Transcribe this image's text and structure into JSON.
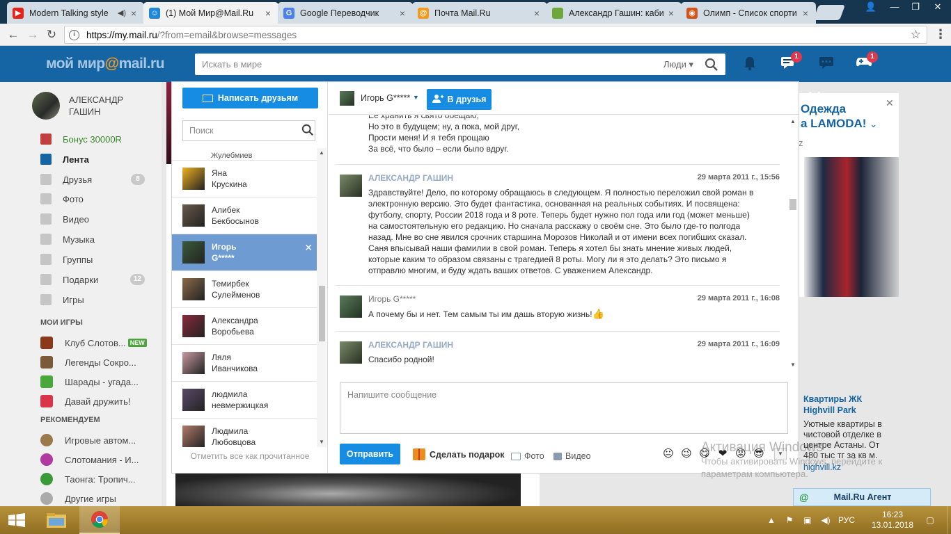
{
  "browser": {
    "tabs": [
      {
        "title": "Modern Talking style",
        "icon": "youtube-icon",
        "color": "#e62117",
        "audio": true
      },
      {
        "title": "(1) Мой Мир@Mail.Ru",
        "icon": "moimir-icon",
        "color": "#1f88d8",
        "active": true
      },
      {
        "title": "Google Переводчик",
        "icon": "google-translate-icon",
        "color": "#4a80ed"
      },
      {
        "title": "Почта Mail.Ru",
        "icon": "mailru-at-icon",
        "color": "#f19a1c"
      },
      {
        "title": "Александр Гашин: каби",
        "icon": "sheet-icon",
        "color": "#6ea83a"
      },
      {
        "title": "Олимп - Список спорти",
        "icon": "olimp-icon",
        "color": "#d3541b"
      }
    ],
    "url_host": "https://my.mail.ru",
    "url_rest": "/?from=email&browse=messages"
  },
  "header": {
    "logo_main": "мой мир",
    "logo_at": "@",
    "logo_suffix": "mail.ru",
    "search_placeholder": "Искать в мире",
    "search_scope": "Люди",
    "messages_badge": "1",
    "games_badge": "1"
  },
  "sidebar": {
    "user_name": "Александр Гашин",
    "items": [
      {
        "label": "Бонус 30000R",
        "type": "bonus"
      },
      {
        "label": "Лента",
        "type": "active"
      },
      {
        "label": "Друзья",
        "count": "8"
      },
      {
        "label": "Фото"
      },
      {
        "label": "Видео"
      },
      {
        "label": "Музыка"
      },
      {
        "label": "Группы"
      },
      {
        "label": "Подарки",
        "count": "12"
      },
      {
        "label": "Игры"
      }
    ],
    "my_games_title": "Мои игры",
    "my_games": [
      {
        "label": "Клуб Слотов...",
        "new": "NEW",
        "color": "#8a3a1a"
      },
      {
        "label": "Легенды Сокро...",
        "color": "#7a5a3a"
      },
      {
        "label": "Шарады - угада...",
        "color": "#4aa83a"
      },
      {
        "label": "Давай дружить!",
        "color": "#d8344a"
      }
    ],
    "recommended_title": "Рекомендуем",
    "recommended": [
      {
        "label": "Игровые автом...",
        "color": "#9a7a4a"
      },
      {
        "label": "Слотомания - И...",
        "color": "#b03aa0"
      },
      {
        "label": "Таонга: Тропич...",
        "color": "#3a9a3a"
      },
      {
        "label": "Другие игры",
        "color": "#aaaaaa"
      }
    ]
  },
  "dialog": {
    "write_friends_label": "Написать друзьям",
    "contacts_search_placeholder": "Поиск",
    "partial_contact": "Жулебмиев",
    "contacts": [
      {
        "name1": "Яна",
        "name2": "Крускина",
        "color": "#f0b020"
      },
      {
        "name1": "Алибек",
        "name2": "Бекбосынов",
        "color": "#6a5a4a"
      },
      {
        "name1": "Игорь",
        "name2": "G*****",
        "color": "#3a5a3a",
        "selected": true
      },
      {
        "name1": "Темирбек",
        "name2": "Сулейменов",
        "color": "#8a6a4a"
      },
      {
        "name1": "Александра",
        "name2": "Воробьева",
        "color": "#8a2a3a"
      },
      {
        "name1": "Ляля",
        "name2": "Иванчикова",
        "color": "#c89aa0"
      },
      {
        "name1": "людмила",
        "name2": "невмержицкая",
        "color": "#5a4a6a"
      },
      {
        "name1": "Людмила",
        "name2": "Любовцова",
        "color": "#b07a6a"
      }
    ],
    "mark_all_read": "Отметить все как прочитанное",
    "chat_name": "Игорь G*****",
    "add_friend_label": "В друзья",
    "poem_lines": [
      "Ее хранить я свято обещаю;",
      "Но это в будущем; ну, а пока, мой друг,",
      "Прости меня! И я тебя прощаю",
      "За всё, что было – если было вдруг."
    ],
    "messages": [
      {
        "author": "АЛЕКСАНДР ГАШИН",
        "date": "29 марта 2011 г., 15:56",
        "text": "Здравствуйте! Дело, по которому обращаюсь в следующем. Я полностью переложил свой роман в электронную версию. Это будет фантастика, основанная на реальных событиях. И посвящена: футболу, спорту, России 2018 года и 8 роте. Теперь будет нужно пол года или год (может меньше) на самостоятельную его редакцию. Но сначала расскажу о своём сне. Это было где-то полгода назад. Мне во сне явился срочник старшина Морозов Николай и от имени всех погибших сказал. Саня впысывай наши фамилии в свой роман. Теперь я хотел бы знать мнение живых людей, которые каким то образом связаны с трагедией 8 роты. Могу ли я это делать? Это письмо я отправлю многим, и буду ждать ваших ответов. С уважением Александр."
      },
      {
        "author": "Игорь G*****",
        "date": "29 марта 2011 г., 16:08",
        "text": "А почему бы и нет. Тем самым ты им дашь вторую жизнь!"
      },
      {
        "author": "АЛЕКСАНДР ГАШИН",
        "date": "29 марта 2011 г., 16:09",
        "text": "Спасибо родной!"
      }
    ],
    "compose_placeholder": "Напишите сообщение",
    "send_label": "Отправить",
    "gift_label": "Сделать подарок",
    "photo_label": "Фото",
    "video_label": "Видео",
    "emojis": [
      "😐",
      "😉",
      "😋",
      "❤",
      "😡",
      "😎"
    ]
  },
  "ads": {
    "lamoda_title_1": "Одежда",
    "lamoda_title_2": "а LAMODA!",
    "lamoda_domain": "z",
    "flat_title": "Квартиры ЖК Highvill Park",
    "flat_text": "Уютные квартиры в чистовой отделке в центре Астаны. От 480 тыс тг за кв м.",
    "flat_link": "highvill.kz"
  },
  "activation": {
    "title": "Активация Windows",
    "text": "Чтобы активировать Windows, перейдите к параметрам компьютера."
  },
  "agent": {
    "label": "Mail.Ru Агент"
  },
  "taskbar": {
    "lang": "РУС",
    "time": "16:23",
    "date": "13.01.2018"
  }
}
